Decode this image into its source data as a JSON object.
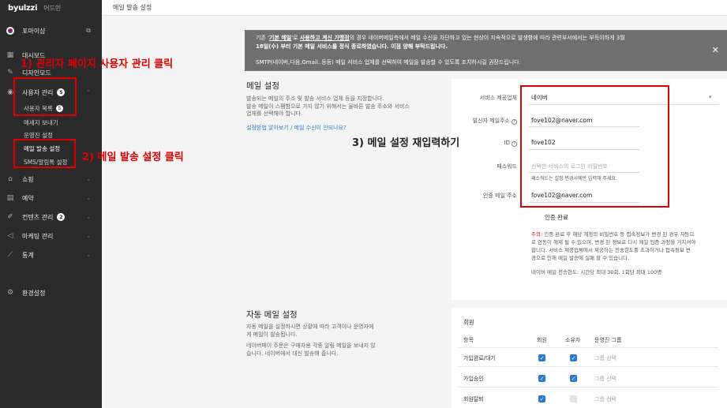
{
  "brand": {
    "logo": "byulzzi",
    "admin": "어드민"
  },
  "topbar": {
    "title": "메일 발송 설정"
  },
  "sidebar": {
    "items": [
      {
        "label": "포마이샵",
        "icon": "flag-icon"
      },
      {
        "label": "대시보드",
        "icon": "dashboard-icon"
      },
      {
        "label": "디자인모드",
        "icon": "brush-icon"
      },
      {
        "label": "사용자 관리",
        "icon": "user-icon",
        "badge": "5"
      },
      {
        "label": "쇼핑",
        "icon": "shop-icon"
      },
      {
        "label": "예약",
        "icon": "calendar-icon"
      },
      {
        "label": "컨텐츠 관리",
        "icon": "content-icon",
        "badge": "2"
      },
      {
        "label": "마케팅 관리",
        "icon": "megaphone-icon"
      },
      {
        "label": "통계",
        "icon": "chart-icon"
      },
      {
        "label": "환경설정",
        "icon": "gear-icon"
      }
    ],
    "sub_items": [
      "사용자 목록",
      "메세지 보내기",
      "운영진 설정",
      "메일 발송 설정",
      "SMS/알림톡 설정"
    ],
    "sub_badge": "5"
  },
  "notice": {
    "line1_pre": "기존 '",
    "line1_u1": "기본 메일",
    "line1_mid": "'로 ",
    "line1_u2": "사용하고 계신 가맹점",
    "line1_post": "의 경우 네이버메일측에서 메일 수신을 차단하고 있는 현상이 지속적으로 발생함에 따라 관련부서에서는 부득이하게 3월",
    "line1b": "18일(수) 부터 기본 메일 서비스를 정식 종료하였습니다. 이점 양해 부탁드립니다.",
    "line2": "SMTP(네이버,다음,Gmail..등등) 메일 서비스 업체를 선택하여 메일을 발송할 수 있도록 조치하시길 권장드립니다.",
    "close": "✕"
  },
  "mail_settings": {
    "title": "메일 설정",
    "desc1": "발송되는 메일의 주소 및 발송 서비스 업체 등을 지정합니다.",
    "desc2": "발송 메일이 스팸함으로 가지 않기 위해서는 올바른 발송 주소와 서비스",
    "desc3": "업체를 선택해야 합니다.",
    "help_link": "설정방법 알아보기 / 메일 수신이 안되나요?",
    "fields": {
      "provider_label": "서비스 제공업체",
      "provider_value": "네이버",
      "sender_label": "발신자 메일주소",
      "sender_value": "fove102@naver.com",
      "id_label": "ID",
      "id_value": "fove102",
      "password_label": "패스워드",
      "password_placeholder": "선택한 서비스의 로그인 비밀번호",
      "password_hint": "패스워드는 설정 변경시에만 입력해 주세요.",
      "verify_label": "인증 메일 주소",
      "verify_value": "fove102@naver.com"
    },
    "verify_done": "인증 완료",
    "caution_label": "주의:",
    "caution1": " 인증 완료 후 해당 계정의 비밀번호 등 접속정보가 변경 된 경우 자동으",
    "caution2": "로 연동이 해제 될 수 있으며, 변경 된 정보로 다시 메일 인증 과정을 거치셔야",
    "caution3": "합니다. 서비스 제공업체에서 제공하는 전송한도를 초과하거나 접속정보 변",
    "caution4": "경으로 인해 메일 발송에 실패 할 수 있습니다.",
    "rate": "네이버 메일 전송한도: 시간당 최대 30회, 1회당 최대 100명"
  },
  "auto_mail": {
    "title": "자동 메일 설정",
    "desc1": "자동 메일을 설정하시면 상황에 따라 고객이나 운영자에",
    "desc2": "게 메일이 발송됩니다.",
    "desc3": "네이버페이 주문은 구매자용 각종 알림 메일을 보내지 않",
    "desc4": "습니다. 네이버에서 대신 발송해 줍니다.",
    "group": "회원",
    "headers": [
      "항목",
      "회원",
      "소유자",
      "운영진 그룹"
    ],
    "rows": [
      {
        "item": "가입완료/대기",
        "member": true,
        "owner": true,
        "group": "그룹 선택"
      },
      {
        "item": "가입승인",
        "member": true,
        "owner": true,
        "group": "그룹 선택"
      },
      {
        "item": "회원탈퇴",
        "member": true,
        "owner": false,
        "group": "그룹 선택"
      }
    ]
  },
  "annotations": {
    "step1": "1) 관리자 페이지 사용자 관리 클릭",
    "step2": "2) 메일 발송 설정 클릭",
    "step3": "3) 메일 설정 재입력하기",
    "color": "#e00000"
  }
}
